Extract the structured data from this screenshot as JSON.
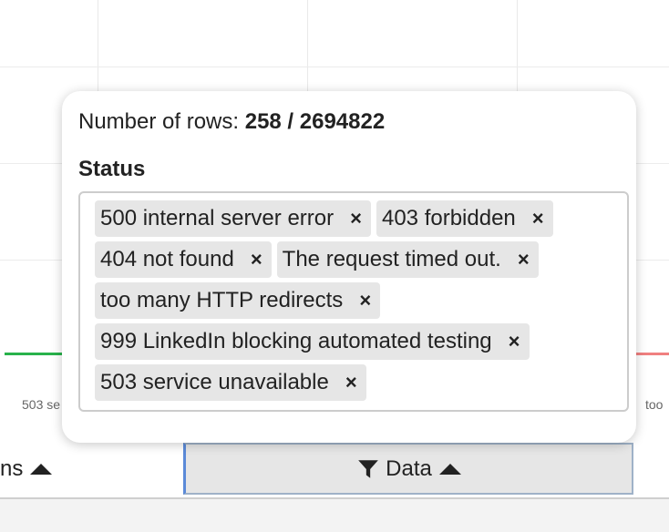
{
  "chart": {
    "x_labels_partial": [
      "503 se",
      "too"
    ],
    "colors": {
      "green_series": "#28b24b",
      "red_series": "#f08080"
    }
  },
  "popover": {
    "rows_label": "Number of rows: ",
    "rows_value": "258 / 2694822",
    "status_title": "Status",
    "tags": [
      {
        "label": "500 internal server error",
        "remove": "×"
      },
      {
        "label": "403 forbidden",
        "remove": "×"
      },
      {
        "label": "404 not found",
        "remove": "×"
      },
      {
        "label": "The request timed out.",
        "remove": "×"
      },
      {
        "label": "too many HTTP redirects",
        "remove": "×"
      },
      {
        "label": "999 LinkedIn blocking automated testing",
        "remove": "×"
      },
      {
        "label": "503 service unavailable",
        "remove": "×"
      }
    ]
  },
  "toolbar": {
    "left_button_label": "ns",
    "data_button_label": "Data",
    "data_button_icon": "filter-icon",
    "accent": "#5b8ad8"
  }
}
